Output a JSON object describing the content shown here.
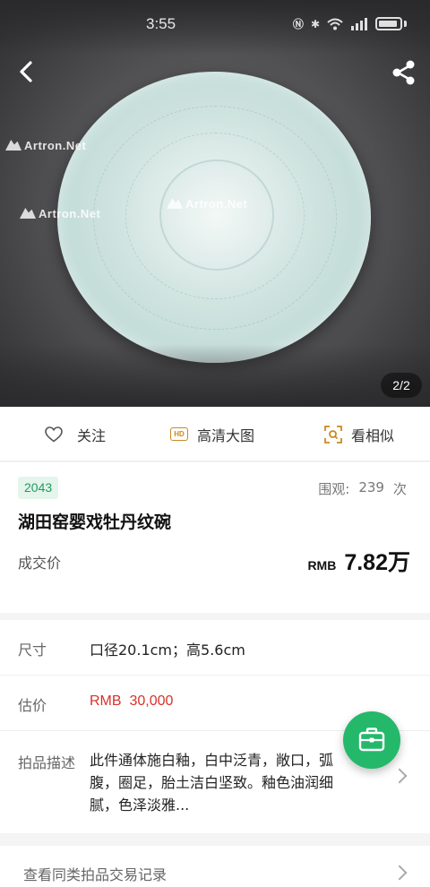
{
  "status_bar": {
    "time": "3:55"
  },
  "hero": {
    "watermark_text": "Artron.Net",
    "counter": "2/2"
  },
  "actions": {
    "follow": "关注",
    "hd_badge": "HD",
    "hd": "高清大图",
    "similar": "看相似"
  },
  "lot": {
    "number": "2043",
    "views_label": "围观:",
    "views_count": "239",
    "views_unit": "次",
    "title": "湖田窑婴戏牡丹纹碗",
    "deal_label": "成交价",
    "price_currency": "RMB",
    "price_value": "7.82万"
  },
  "details": {
    "size_label": "尺寸",
    "size_value": "口径20.1cm；高5.6cm",
    "estimate_label": "估价",
    "estimate_value": "RMB  30,000",
    "desc_label": "拍品描述",
    "desc_value": "此件通体施白釉，白中泛青，敞口，弧腹，圈足，胎土洁白坚致。釉色油润细腻，色泽淡雅..."
  },
  "records": {
    "label": "查看同类拍品交易记录"
  },
  "colors": {
    "accent_green": "#24b86b",
    "estimate_red": "#d8312b",
    "hd_gold": "#c98a1e"
  }
}
